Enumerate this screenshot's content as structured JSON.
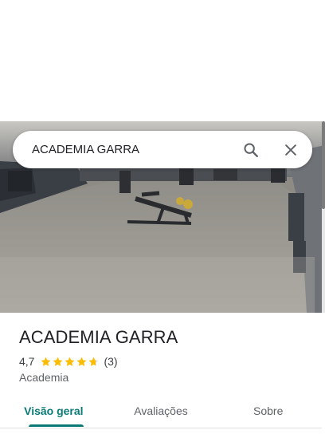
{
  "search": {
    "value": "ACADEMIA GARRA",
    "search_icon": "search-icon",
    "close_icon": "close-icon"
  },
  "photo": {
    "subject": "gym-interior-photo"
  },
  "place": {
    "name": "ACADEMIA GARRA",
    "rating": "4,7",
    "rating_value": 4.7,
    "stars_max": 5,
    "review_count": "(3)",
    "category": "Academia"
  },
  "tabs": [
    {
      "label": "Visão geral",
      "active": true
    },
    {
      "label": "Avaliações",
      "active": false
    },
    {
      "label": "Sobre",
      "active": false
    }
  ],
  "colors": {
    "accent": "#0b7a76",
    "star": "#fbbc04"
  }
}
